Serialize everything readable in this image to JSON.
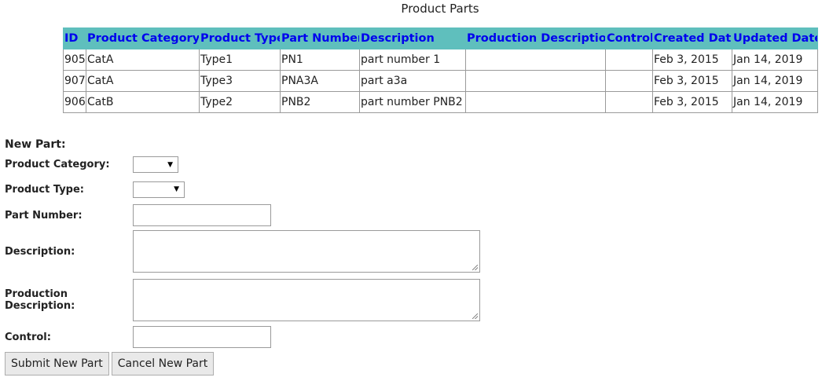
{
  "page": {
    "title": "Product Parts"
  },
  "table": {
    "columns": [
      "ID",
      "Product Category",
      "Product Type",
      "Part Number",
      "Description",
      "Production Description",
      "Control",
      "Created Date",
      "Updated Date"
    ],
    "sort_indicator": "↑",
    "rows": [
      [
        "905",
        "CatA",
        "Type1",
        "PN1",
        "part number 1",
        "",
        "",
        "Feb 3, 2015",
        "Jan 14, 2019"
      ],
      [
        "907",
        "CatA",
        "Type3",
        "PNA3A",
        "part a3a",
        "",
        "",
        "Feb 3, 2015",
        "Jan 14, 2019"
      ],
      [
        "906",
        "CatB",
        "Type2",
        "PNB2",
        "part number PNB2",
        "",
        "",
        "Feb 3, 2015",
        "Jan 14, 2019"
      ]
    ]
  },
  "form": {
    "heading": "New Part:",
    "product_category_label": "Product Category:",
    "product_category_value": "",
    "product_type_label": "Product Type:",
    "product_type_value": "",
    "part_number_label": "Part Number:",
    "part_number_value": "",
    "description_label": "Description:",
    "description_value": "",
    "production_description_label": "Production Description:",
    "production_description_value": "",
    "control_label": "Control:",
    "control_value": "",
    "submit_label": "Submit New Part",
    "cancel_label": "Cancel New Part"
  },
  "colors": {
    "header_bg": "#5fbfbd",
    "header_text": "#0000ee"
  }
}
